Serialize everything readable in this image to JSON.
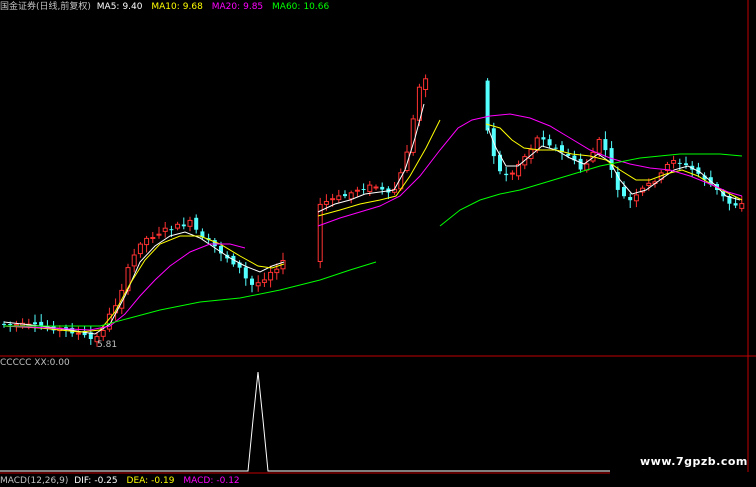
{
  "header": {
    "title": "国金证券(日线,前复权)",
    "ma5_label": "MA5:",
    "ma5_value": "9.40",
    "ma10_label": "MA10:",
    "ma10_value": "9.68",
    "ma20_label": "MA20:",
    "ma20_value": "9.85",
    "ma60_label": "MA60:",
    "ma60_value": "10.66"
  },
  "low_marker": "5.81",
  "indicator": {
    "label": "CCCCC",
    "xx_label": "XX:",
    "xx_value": "0.00"
  },
  "macd": {
    "label": "MACD(12,26,9)",
    "dif_label": "DIF:",
    "dif_value": "-0.25",
    "dea_label": "DEA:",
    "dea_value": "-0.19",
    "macd_label": "MACD:",
    "macd_value": "-0.12"
  },
  "watermark": "www.7gpzb.com",
  "colors": {
    "background": "#000000",
    "up": "#ff3232",
    "down": "#54ffff",
    "ma5": "#ffffff",
    "ma10": "#ffff00",
    "ma20": "#ff00ff",
    "ma60": "#00ff00",
    "separator": "#c00000",
    "header_title": "#c0c0c0",
    "watermark": "#ffffff"
  },
  "chart_data": {
    "type": "candlestick",
    "title": "国金证券(日线,前复权)",
    "moving_averages": [
      {
        "name": "MA5",
        "value": 9.4
      },
      {
        "name": "MA10",
        "value": 9.68
      },
      {
        "name": "MA20",
        "value": 9.85
      },
      {
        "name": "MA60",
        "value": 10.66
      }
    ],
    "low_marker": 5.81,
    "indicator": {
      "name": "CCCCC",
      "XX": 0.0
    },
    "macd": {
      "params": [
        12,
        26,
        9
      ],
      "DIF": -0.25,
      "DEA": -0.19,
      "MACD": -0.12
    }
  }
}
